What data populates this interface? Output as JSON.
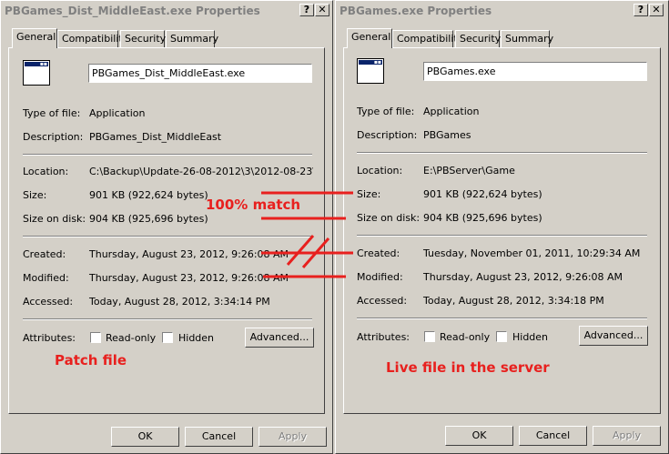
{
  "left_window": {
    "title": "PBGames_Dist_MiddleEast.exe Properties",
    "help_button": "?",
    "close_button": "✕",
    "tabs": [
      "General",
      "Compatibility",
      "Security",
      "Summary"
    ],
    "filename": "PBGames_Dist_MiddleEast.exe",
    "type_label": "Type of file:",
    "type_value": "Application",
    "desc_label": "Description:",
    "desc_value": "PBGames_Dist_MiddleEast",
    "location_label": "Location:",
    "location_value": "C:\\Backup\\Update-26-08-2012\\3\\2012-08-23\\Serv",
    "size_label": "Size:",
    "size_value": "901 KB (922,624 bytes)",
    "size_disk_label": "Size on disk:",
    "size_disk_value": "904 KB (925,696 bytes)",
    "created_label": "Created:",
    "created_value": "Thursday, August 23, 2012, 9:26:08 AM",
    "modified_label": "Modified:",
    "modified_value": "Thursday, August 23, 2012, 9:26:08 AM",
    "accessed_label": "Accessed:",
    "accessed_value": "Today, August 28, 2012, 3:34:14 PM",
    "attributes_label": "Attributes:",
    "readonly_label": "Read-only",
    "hidden_label": "Hidden",
    "advanced_label": "Advanced...",
    "ok_label": "OK",
    "cancel_label": "Cancel",
    "apply_label": "Apply"
  },
  "right_window": {
    "title": "PBGames.exe Properties",
    "help_button": "?",
    "close_button": "✕",
    "tabs": [
      "General",
      "Compatibility",
      "Security",
      "Summary"
    ],
    "filename": "PBGames.exe",
    "type_label": "Type of file:",
    "type_value": "Application",
    "desc_label": "Description:",
    "desc_value": "PBGames",
    "location_label": "Location:",
    "location_value": "E:\\PBServer\\Game",
    "size_label": "Size:",
    "size_value": "901 KB (922,624 bytes)",
    "size_disk_label": "Size on disk:",
    "size_disk_value": "904 KB (925,696 bytes)",
    "created_label": "Created:",
    "created_value": "Tuesday, November 01, 2011, 10:29:34 AM",
    "modified_label": "Modified:",
    "modified_value": "Thursday, August 23, 2012, 9:26:08 AM",
    "accessed_label": "Accessed:",
    "accessed_value": "Today, August 28, 2012, 3:34:18 PM",
    "attributes_label": "Attributes:",
    "readonly_label": "Read-only",
    "hidden_label": "Hidden",
    "advanced_label": "Advanced...",
    "ok_label": "OK",
    "cancel_label": "Cancel",
    "apply_label": "Apply"
  },
  "annotations": {
    "match": "100% match",
    "patch": "Patch file",
    "live": "Live file in the server"
  },
  "colors": {
    "annotation": "#e8201e",
    "dialog_bg": "#d4d0c8"
  }
}
